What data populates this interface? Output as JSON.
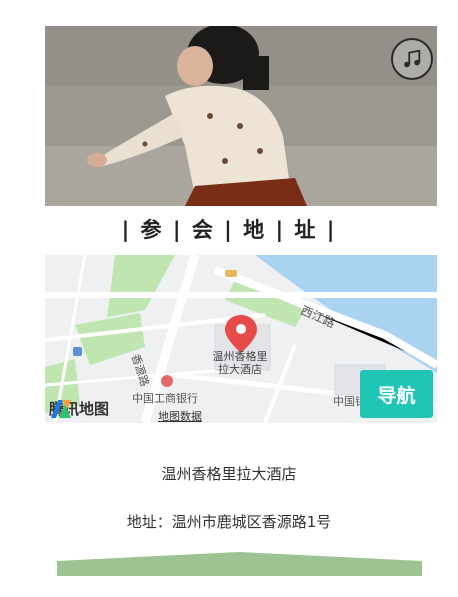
{
  "section": {
    "title": "| 参 | 会 | 地 | 址 |"
  },
  "map": {
    "hotel_marker_label_line1": "温州香格里",
    "hotel_marker_label_line2": "拉大酒店",
    "road_xijiang": "西江路",
    "road_xiangyuan": "香源路",
    "bank_label": "中国工商银行",
    "partial_label": "中国银",
    "provider": "腾讯地图",
    "map_data_link": "地图数据"
  },
  "nav_button": {
    "label": "导航"
  },
  "venue": {
    "name": "温州香格里拉大酒店",
    "address": "地址：温州市鹿城区香源路1号"
  },
  "colors": {
    "accent": "#21c5b5",
    "bar": "#9dc393",
    "water": "#a9d3f0",
    "park": "#bfe6b0"
  },
  "icons": {
    "music": "music-note-icon",
    "marker": "map-pin-icon",
    "logo": "tencent-map-logo-icon"
  }
}
